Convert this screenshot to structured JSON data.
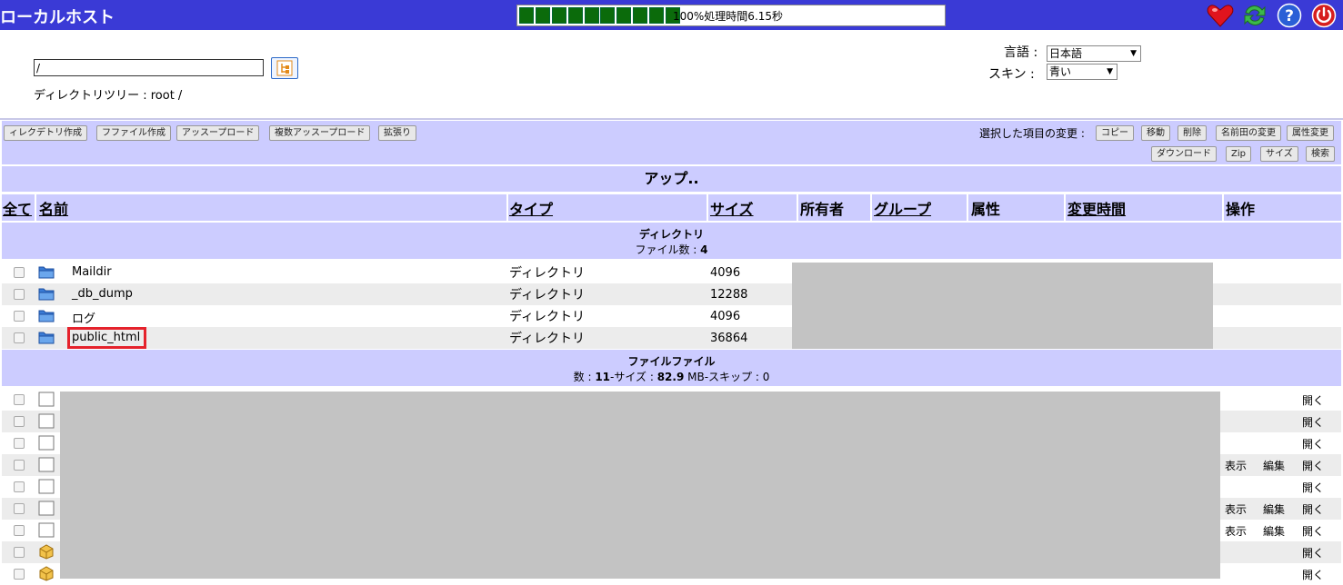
{
  "header": {
    "title": "ローカルホスト",
    "progress": {
      "percent": 100,
      "segments": 10,
      "text": "100%処理時間6.15秒"
    },
    "icons": [
      "heart-icon",
      "refresh-icon",
      "help-icon",
      "power-icon"
    ],
    "colors": {
      "bar": "#3a3ad6",
      "progress_fill": "#0b6b0b"
    }
  },
  "top_panel": {
    "path_value": "/",
    "dir_tree": "ディレクトリツリー : root /",
    "lang_label": "言語 :",
    "lang_value": "日本語",
    "skin_label": "スキン :",
    "skin_value": "青い"
  },
  "toolbar": {
    "left_buttons": [
      "ィレクデトリ作成",
      "フファイル作成",
      "アッスープロード",
      "複数アッスープロード",
      "拡張り"
    ],
    "selected_label": "選択した項目の変更 :",
    "right_row1": [
      "コピー",
      "移動",
      "削除",
      "名前田の変更",
      "属性変更"
    ],
    "right_row2": [
      "ダウンロード",
      "Zip",
      "サイズ",
      "検索"
    ]
  },
  "up_row": "アップ..",
  "columns": {
    "all": "全て",
    "name": "名前",
    "type": "タイプ",
    "size": "サイズ",
    "owner": "所有者",
    "group": "グループ",
    "attr": "属性",
    "mtime": "変更時間",
    "ops": "操作"
  },
  "dir_section": {
    "title": "ディレクトリ",
    "count_label": "ファイル数 : ",
    "count": "4"
  },
  "directories": [
    {
      "name": "Maildir",
      "type": "ディレクトリ",
      "size": "4096"
    },
    {
      "name": "_db_dump",
      "type": "ディレクトリ",
      "size": "12288"
    },
    {
      "name": "ログ",
      "type": "ディレクトリ",
      "size": "4096"
    },
    {
      "name": "public_html",
      "type": "ディレクトリ",
      "size": "36864"
    }
  ],
  "file_section": {
    "title": "ファイルファイル",
    "count_label": "数 : ",
    "count": "11",
    "size_label": "-サイズ : ",
    "size": "82.9",
    "skip_label": " MB-スキップ : 0"
  },
  "file_actions": {
    "open": "開く",
    "view": "表示",
    "edit": "編集"
  },
  "files": [
    {
      "icon": "file-icon",
      "view": false
    },
    {
      "icon": "file-icon",
      "view": false
    },
    {
      "icon": "file-icon",
      "view": false
    },
    {
      "icon": "file-icon",
      "view": true
    },
    {
      "icon": "file-icon",
      "view": false
    },
    {
      "icon": "file-icon",
      "view": true
    },
    {
      "icon": "file-icon",
      "view": true
    },
    {
      "icon": "package-icon",
      "view": false
    },
    {
      "icon": "package-icon",
      "view": false
    }
  ]
}
